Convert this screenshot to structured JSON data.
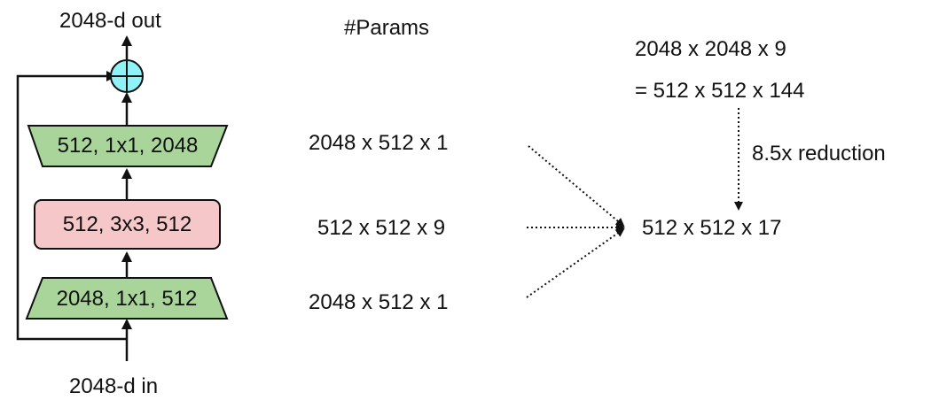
{
  "diagram": {
    "output_label": "2048-d out",
    "input_label": "2048-d in",
    "blocks": {
      "top": "512, 1x1, 2048",
      "middle": "512, 3x3, 512",
      "bottom": "2048, 1x1, 512"
    },
    "colors": {
      "conv1x1_fill": "#a9d59b",
      "conv3x3_fill": "#f6c7c8",
      "adder_fill": "#8ff2f6",
      "stroke": "#111111"
    }
  },
  "params": {
    "header": "#Params",
    "rows": [
      "2048 x 512 x 1",
      "512 x 512 x 9",
      "2048 x 512 x 1"
    ],
    "original_line1": "2048 x 2048 x 9",
    "original_line2": "= 512 x 512 x 144",
    "reduction_label": "8.5x reduction",
    "result": "512 x 512 x 17"
  }
}
